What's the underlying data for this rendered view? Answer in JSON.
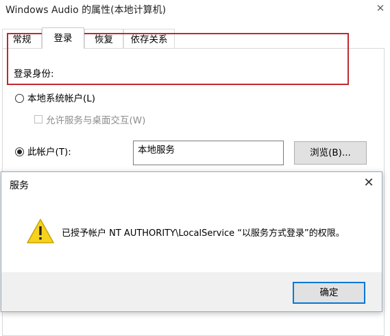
{
  "properties_window": {
    "title": "Windows Audio 的属性(本地计算机)",
    "close_glyph": "✕",
    "tabs": [
      {
        "label": "常规"
      },
      {
        "label": "登录"
      },
      {
        "label": "恢复"
      },
      {
        "label": "依存关系"
      }
    ],
    "active_tab": "登录",
    "logon_as_label": "登录身份:",
    "local_system_label": "本地系统帐户(L)",
    "local_system_checked": false,
    "allow_desktop_label": "允许服务与桌面交互(W)",
    "allow_desktop_checked": false,
    "this_account_label": "此帐户(T):",
    "this_account_checked": true,
    "account_value": "本地服务",
    "browse_label": "浏览(B)..."
  },
  "message_dialog": {
    "title": "服务",
    "close_glyph": "✕",
    "icon": "warning-icon",
    "message": "已授予帐户 NT AUTHORITY\\LocalService “以服务方式登录”的权限。",
    "ok_label": "确定"
  },
  "colors": {
    "highlight_border": "#c0272d",
    "warning_fill": "#f7d21c",
    "default_button_border": "#0078d7"
  }
}
